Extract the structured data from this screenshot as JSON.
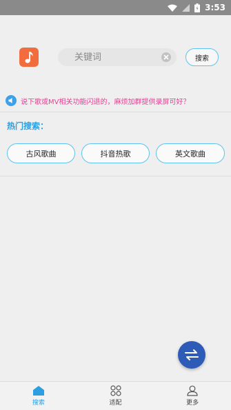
{
  "status_bar": {
    "time": "3:53"
  },
  "search": {
    "placeholder": "关键词",
    "button_label": "搜索"
  },
  "notice": {
    "text": "说下歌或MV相关功能闪退的，麻烦加群提供录屏可好？"
  },
  "hot": {
    "title": "热门搜索：",
    "tags": [
      "古风歌曲",
      "抖音热歌",
      "英文歌曲"
    ]
  },
  "bottom_nav": [
    {
      "label": "搜索",
      "icon": "home-icon",
      "active": true
    },
    {
      "label": "适配",
      "icon": "grid-circles-icon",
      "active": false
    },
    {
      "label": "更多",
      "icon": "person-icon",
      "active": false
    }
  ],
  "colors": {
    "accent": "#2b9fe0",
    "tag_border": "#5dc3ee",
    "notice_text": "#e43f93",
    "app_icon": "#f26d3d",
    "fab": "#2f5bb8"
  }
}
